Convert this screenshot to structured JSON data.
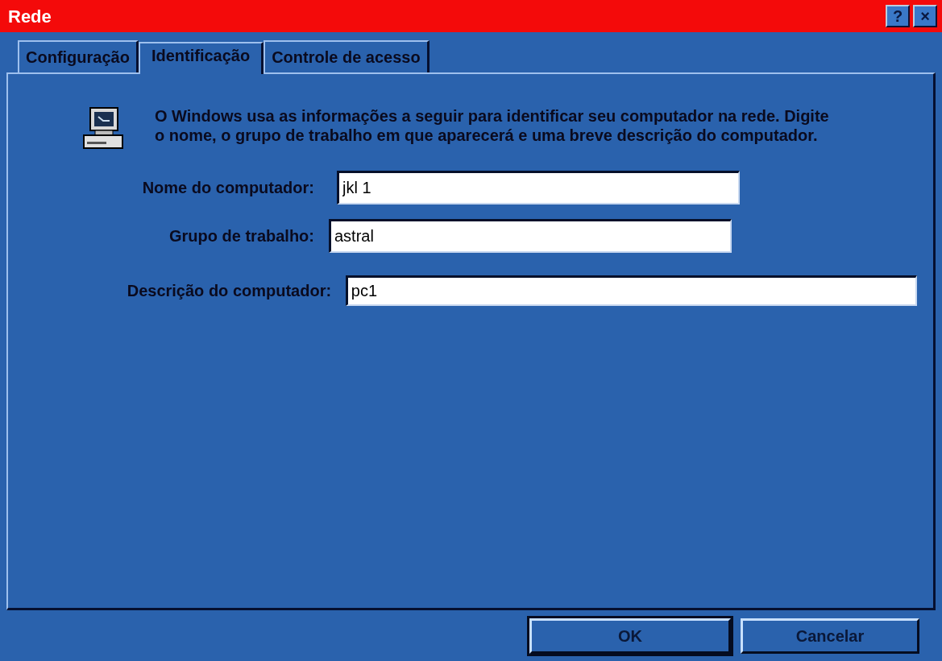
{
  "window": {
    "title": "Rede",
    "buttons": [
      {
        "label": "?"
      },
      {
        "label": "×"
      }
    ]
  },
  "tabs": [
    {
      "label": "Configuração",
      "selected": false
    },
    {
      "label": "Identificação",
      "selected": true
    },
    {
      "label": "Controle de acesso",
      "selected": false
    }
  ],
  "intro": "O Windows usa as informações a seguir para identificar seu computador na rede. Digite o nome, o grupo de trabalho em que aparecerá e uma breve descrição do computador.",
  "fields": [
    {
      "label": "Nome do computador:",
      "value": "jkl 1"
    },
    {
      "label": "Grupo de trabalho:",
      "value": "astral"
    },
    {
      "label": "Descrição do computador:",
      "value": "pc1"
    }
  ],
  "buttons": [
    {
      "label": "OK",
      "default": true
    },
    {
      "label": "Cancelar",
      "default": false
    }
  ]
}
